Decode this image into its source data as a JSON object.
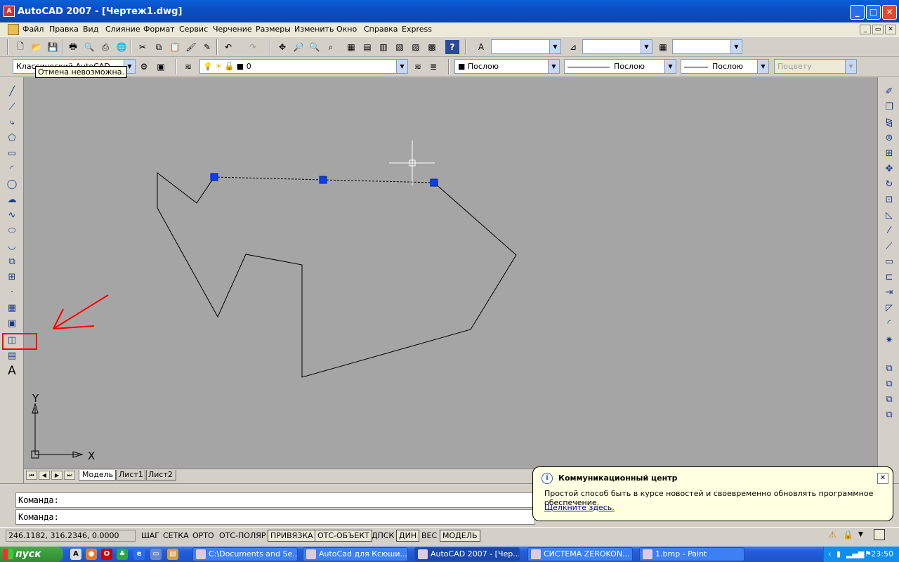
{
  "window": {
    "title": "AutoCAD 2007 - [Чертеж1.dwg]",
    "min": "_",
    "max": "□",
    "close": "✕"
  },
  "menu": [
    "Файл",
    "Правка",
    "Вид",
    "Слияние",
    "Формат",
    "Сервис",
    "Черчение",
    "Размеры",
    "Изменить",
    "Окно",
    "Справка",
    "Express"
  ],
  "doc_controls": {
    "min": "_",
    "restore": "▭",
    "close": "✕"
  },
  "toolbar2": {
    "workspace_text": "Классический AutoCAD",
    "layer_value": "0",
    "color_value": "Послою",
    "linetype_value": "Послою",
    "lineweight_value": "Послою",
    "plotstyle_value": "Поцвету"
  },
  "tooltip": "Отмена невозможна.",
  "tabs": {
    "model": "Модель",
    "sheet1": "Лист1",
    "sheet2": "Лист2"
  },
  "ucs": {
    "x": "X",
    "y": "Y"
  },
  "command": {
    "line1": "Команда:",
    "line2": "Команда:"
  },
  "status": {
    "coords": "246.1182, 316.2346, 0.0000",
    "buttons": [
      {
        "label": "ШАГ",
        "on": false
      },
      {
        "label": "СЕТКА",
        "on": false
      },
      {
        "label": "ОРТО",
        "on": false
      },
      {
        "label": "ОТС-ПОЛЯР",
        "on": false
      },
      {
        "label": "ПРИВЯЗКА",
        "on": true
      },
      {
        "label": "ОТС-ОБЪЕКТ",
        "on": true
      },
      {
        "label": "ДПСК",
        "on": false
      },
      {
        "label": "ДИН",
        "on": true
      },
      {
        "label": "ВЕС",
        "on": false
      },
      {
        "label": "МОДЕЛЬ",
        "on": true
      }
    ]
  },
  "balloon": {
    "title": "Коммуникационный центр",
    "message": "Простой способ быть в курсе новостей и своевременно обновлять программное обеспечение.",
    "link": "Щелкните здесь."
  },
  "taskbar": {
    "start": "пуск",
    "items": [
      {
        "label": "C:\\Documents and Se...",
        "active": false
      },
      {
        "label": "AutoCad для Ксюши...",
        "active": false
      },
      {
        "label": "AutoCAD 2007 - [Чер...",
        "active": true
      },
      {
        "label": "СИСТЕМА ZEROKON...",
        "active": false
      },
      {
        "label": "1.bmp - Paint",
        "active": false
      }
    ],
    "clock": "23:50"
  },
  "colors": {
    "canvas": "#a5a5a5",
    "grip": "#0a3df5",
    "annotation": "#ff0000"
  }
}
